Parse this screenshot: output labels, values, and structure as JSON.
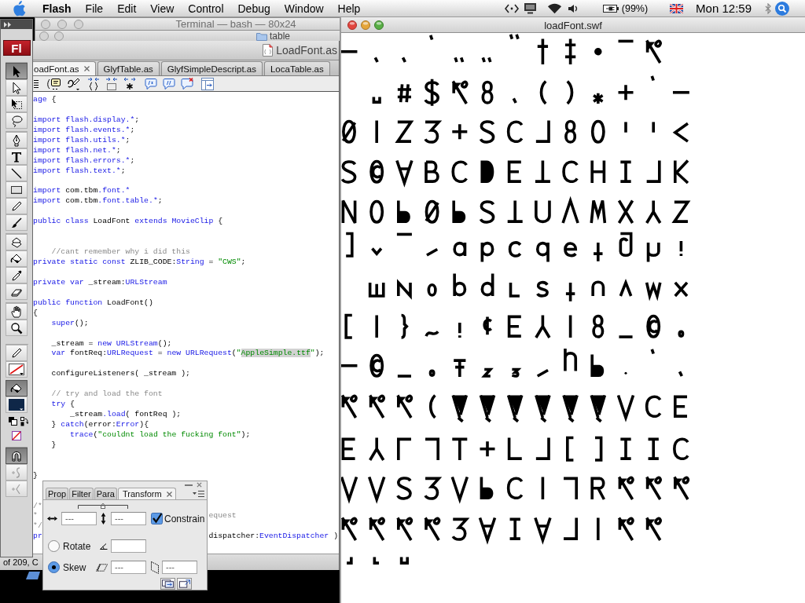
{
  "menubar": {
    "app": "Flash",
    "items": [
      "File",
      "Edit",
      "View",
      "Control",
      "Debug",
      "Window",
      "Help"
    ],
    "battery": "(99%)",
    "clock": "Mon 12:59"
  },
  "terminal_window": {
    "title": "Terminal — bash — 80x24"
  },
  "finder_window": {
    "title": "table"
  },
  "editor_window": {
    "title": "LoadFont.as",
    "tabs": [
      {
        "label": "oadFont.as",
        "selected": true
      },
      {
        "label": "GlyfTable.as",
        "selected": false
      },
      {
        "label": "GlyfSimpleDescript.as",
        "selected": false
      },
      {
        "label": "LocaTable.as",
        "selected": false
      }
    ],
    "code": [
      {
        "tokens": [
          {
            "kind": "kw",
            "text": "age"
          },
          {
            "kind": "plain",
            "text": " {"
          }
        ]
      },
      {
        "kind": "blank"
      },
      {
        "tokens": [
          {
            "kind": "kw",
            "text": "import flash.display.*"
          },
          {
            "kind": "plain",
            "text": ";"
          }
        ]
      },
      {
        "tokens": [
          {
            "kind": "kw",
            "text": "import flash.events.*"
          },
          {
            "kind": "plain",
            "text": ";"
          }
        ]
      },
      {
        "tokens": [
          {
            "kind": "kw",
            "text": "import flash.utils.*"
          },
          {
            "kind": "plain",
            "text": ";"
          }
        ]
      },
      {
        "tokens": [
          {
            "kind": "kw",
            "text": "import flash.net.*"
          },
          {
            "kind": "plain",
            "text": ";"
          }
        ]
      },
      {
        "tokens": [
          {
            "kind": "kw",
            "text": "import flash.errors.*"
          },
          {
            "kind": "plain",
            "text": ";"
          }
        ]
      },
      {
        "tokens": [
          {
            "kind": "kw",
            "text": "import flash.text.*"
          },
          {
            "kind": "plain",
            "text": ";"
          }
        ]
      },
      {
        "kind": "blank"
      },
      {
        "tokens": [
          {
            "kind": "kw",
            "text": "import"
          },
          {
            "kind": "plain",
            "text": " com.tbm"
          },
          {
            "kind": "kw",
            "text": ".font.*"
          }
        ]
      },
      {
        "tokens": [
          {
            "kind": "kw",
            "text": "import"
          },
          {
            "kind": "plain",
            "text": " com.tbm"
          },
          {
            "kind": "kw",
            "text": ".font.table.*"
          },
          {
            "kind": "plain",
            "text": ";"
          }
        ]
      },
      {
        "kind": "blank"
      },
      {
        "tokens": [
          {
            "kind": "kw",
            "text": "public class"
          },
          {
            "kind": "plain",
            "text": " LoadFont "
          },
          {
            "kind": "kw",
            "text": "extends MovieClip"
          },
          {
            "kind": "plain",
            "text": " {"
          }
        ]
      },
      {
        "kind": "blank"
      },
      {
        "kind": "blank"
      },
      {
        "tokens": [
          {
            "kind": "cmt",
            "text": "    //cant remember why i did this"
          }
        ]
      },
      {
        "tokens": [
          {
            "kind": "kw",
            "text": "private static const"
          },
          {
            "kind": "plain",
            "text": " ZLIB_CODE:"
          },
          {
            "kind": "kw",
            "text": "String"
          },
          {
            "kind": "plain",
            "text": " = "
          },
          {
            "kind": "str",
            "text": "\"CWS\""
          },
          {
            "kind": "plain",
            "text": ";"
          }
        ]
      },
      {
        "kind": "blank"
      },
      {
        "tokens": [
          {
            "kind": "kw",
            "text": "private var"
          },
          {
            "kind": "plain",
            "text": " _stream:"
          },
          {
            "kind": "kw",
            "text": "URLStream"
          }
        ]
      },
      {
        "kind": "blank"
      },
      {
        "tokens": [
          {
            "kind": "kw",
            "text": "public function"
          },
          {
            "kind": "plain",
            "text": " LoadFont()"
          }
        ]
      },
      {
        "tokens": [
          {
            "kind": "plain",
            "text": "{"
          }
        ]
      },
      {
        "tokens": [
          {
            "kind": "kw",
            "text": "    super"
          },
          {
            "kind": "plain",
            "text": "();"
          }
        ]
      },
      {
        "kind": "blank"
      },
      {
        "tokens": [
          {
            "kind": "plain",
            "text": "    _stream = "
          },
          {
            "kind": "kw",
            "text": "new URLStream"
          },
          {
            "kind": "plain",
            "text": "();"
          }
        ]
      },
      {
        "tokens": [
          {
            "kind": "kw",
            "text": "    var"
          },
          {
            "kind": "plain",
            "text": " fontReq:"
          },
          {
            "kind": "kw",
            "text": "URLRequest"
          },
          {
            "kind": "plain",
            "text": " = "
          },
          {
            "kind": "kw",
            "text": "new URLRequest"
          },
          {
            "kind": "plain",
            "text": "("
          },
          {
            "kind": "str",
            "text": "\""
          },
          {
            "kind": "sel",
            "text": "AppleSimple.ttf"
          },
          {
            "kind": "str",
            "text": "\""
          },
          {
            "kind": "plain",
            "text": ");"
          }
        ]
      },
      {
        "kind": "blank"
      },
      {
        "tokens": [
          {
            "kind": "plain",
            "text": "    configureListeners( _stream );"
          }
        ]
      },
      {
        "kind": "blank"
      },
      {
        "tokens": [
          {
            "kind": "cmt",
            "text": "    // try and load the font"
          }
        ]
      },
      {
        "tokens": [
          {
            "kind": "kw",
            "text": "    try"
          },
          {
            "kind": "plain",
            "text": " {"
          }
        ]
      },
      {
        "tokens": [
          {
            "kind": "plain",
            "text": "        _stream"
          },
          {
            "kind": "kw",
            "text": ".load"
          },
          {
            "kind": "plain",
            "text": "( fontReq );"
          }
        ]
      },
      {
        "tokens": [
          {
            "kind": "plain",
            "text": "    } "
          },
          {
            "kind": "kw",
            "text": "catch"
          },
          {
            "kind": "plain",
            "text": "(error:"
          },
          {
            "kind": "kw",
            "text": "Error"
          },
          {
            "kind": "plain",
            "text": "){"
          }
        ]
      },
      {
        "tokens": [
          {
            "kind": "kw",
            "text": "        trace"
          },
          {
            "kind": "plain",
            "text": "("
          },
          {
            "kind": "str",
            "text": "\"couldnt load the fucking font\""
          },
          {
            "kind": "plain",
            "text": ");"
          }
        ]
      },
      {
        "tokens": [
          {
            "kind": "plain",
            "text": "    }"
          }
        ]
      },
      {
        "kind": "blank"
      },
      {
        "kind": "blank"
      },
      {
        "tokens": [
          {
            "kind": "plain",
            "text": "}"
          }
        ]
      },
      {
        "kind": "blank"
      },
      {
        "kind": "blank"
      },
      {
        "tokens": [
          {
            "kind": "cmt",
            "text": "/*"
          }
        ]
      },
      {
        "tokens": [
          {
            "kind": "cmt",
            "text": "*"
          }
        ],
        "tail": [
          {
            "kind": "cmt",
            "text": "equest"
          }
        ]
      },
      {
        "tokens": [
          {
            "kind": "cmt",
            "text": "*/"
          }
        ]
      },
      {
        "tokens": [
          {
            "kind": "kw",
            "text": "pr"
          }
        ],
        "tail": [
          {
            "kind": "plain",
            "text": "dispatcher:"
          },
          {
            "kind": "kw",
            "text": "EventDispatcher"
          },
          {
            "kind": "plain",
            "text": " )"
          }
        ]
      }
    ],
    "status": "of 209, C"
  },
  "tools_panel": {
    "logo": "Fl",
    "groups": [
      {
        "kind": "tools",
        "items": [
          {
            "kind": "arrow",
            "selected": true,
            "disabled": false
          },
          {
            "kind": "subselect",
            "selected": false,
            "disabled": false
          },
          {
            "kind": "free-transform",
            "selected": false,
            "disabled": false
          },
          {
            "kind": "lasso",
            "selected": false,
            "disabled": false
          }
        ]
      },
      {
        "kind": "tools",
        "items": [
          {
            "kind": "pen",
            "selected": false,
            "disabled": false
          },
          {
            "kind": "text",
            "selected": false,
            "disabled": false
          },
          {
            "kind": "line",
            "selected": false,
            "disabled": false
          },
          {
            "kind": "rectangle",
            "selected": false,
            "disabled": false
          },
          {
            "kind": "pencil",
            "selected": false,
            "disabled": false
          },
          {
            "kind": "brush",
            "selected": false,
            "disabled": false
          }
        ]
      },
      {
        "kind": "tools",
        "items": [
          {
            "kind": "ink-bottle",
            "selected": false,
            "disabled": false
          },
          {
            "kind": "paint-bucket",
            "selected": false,
            "disabled": false
          },
          {
            "kind": "eyedropper",
            "selected": false,
            "disabled": false
          },
          {
            "kind": "eraser",
            "selected": false,
            "disabled": false
          }
        ]
      },
      {
        "kind": "tools",
        "items": [
          {
            "kind": "hand",
            "selected": false,
            "disabled": false
          },
          {
            "kind": "zoom",
            "selected": false,
            "disabled": false
          }
        ]
      },
      {
        "kind": "colors",
        "items": [
          {
            "kind": "stroke-pencil",
            "selected": false,
            "disabled": false
          },
          {
            "kind": "stroke-swatch",
            "selected": false,
            "disabled": false
          },
          {
            "kind": "fill-bucket",
            "selected": true,
            "disabled": false
          },
          {
            "kind": "fill-swatch",
            "selected": false,
            "disabled": false,
            "color": "#0f2748"
          }
        ]
      },
      {
        "kind": "tools",
        "items": [
          {
            "kind": "magnet",
            "selected": true,
            "disabled": false
          },
          {
            "kind": "smooth",
            "selected": false,
            "disabled": true
          },
          {
            "kind": "straighten",
            "selected": false,
            "disabled": true
          }
        ]
      }
    ]
  },
  "transform_panel": {
    "tabs": [
      {
        "label": "Prop",
        "selected": false
      },
      {
        "label": "Filter",
        "selected": false
      },
      {
        "label": "Para",
        "selected": false
      },
      {
        "label": "Transform",
        "selected": true
      }
    ],
    "width": "---",
    "height": "---",
    "constrain": {
      "label": "Constrain",
      "checked": true
    },
    "modes": [
      {
        "kind": "rotate",
        "label": "Rotate",
        "selected": false
      },
      {
        "kind": "skew",
        "label": "Skew",
        "selected": true,
        "values": [
          "---",
          "---"
        ]
      }
    ]
  },
  "player_window": {
    "title": "loadFont.swf"
  }
}
